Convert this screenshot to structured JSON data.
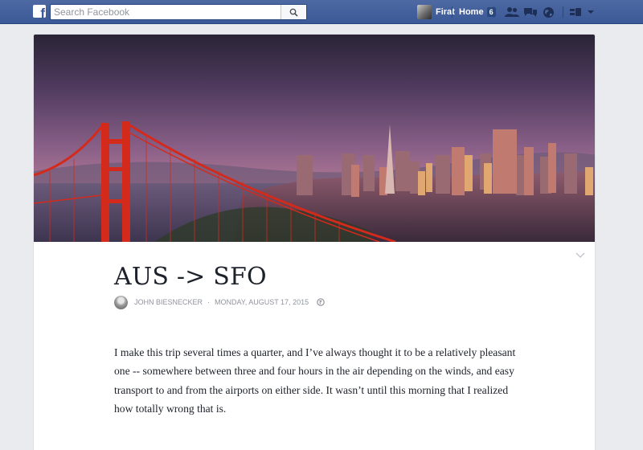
{
  "topbar": {
    "brand_letter": "f",
    "search_placeholder": "Search Facebook",
    "profile_name": "Firat",
    "home_label": "Home",
    "home_count": "6"
  },
  "icons": {
    "logo": "facebook-logo-icon",
    "search": "search-icon",
    "friends": "friend-requests-icon",
    "messages": "messages-icon",
    "notifications": "globe-notifications-icon",
    "settings": "privacy-shortcuts-icon",
    "menu": "chevron-down-icon",
    "audience": "globe-audience-icon"
  },
  "note": {
    "title": "AUS -> SFO",
    "author": "JOHN BIESNECKER",
    "separator": "·",
    "date": "MONDAY, AUGUST 17, 2015",
    "body": "I make this trip several times a quarter, and I’ve always thought it to be a relatively pleasant one -- somewhere between three and four hours in the air depending on the winds, and easy transport to and from the airports on either side. It wasn’t until this morning that I realized how totally wrong that is."
  },
  "colors": {
    "brand": "#3b5998",
    "bridge": "#d42a1c",
    "page_bg": "#e9ebee"
  }
}
